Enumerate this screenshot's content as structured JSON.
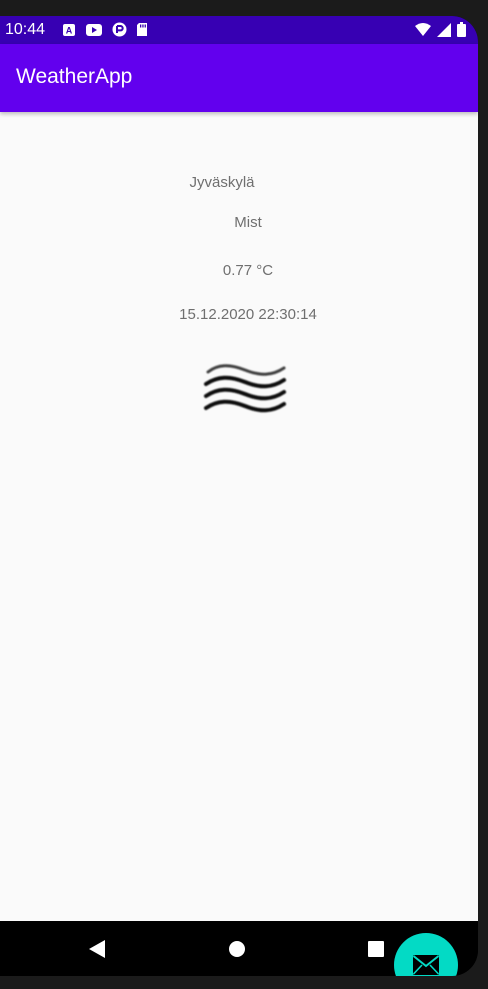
{
  "status_bar": {
    "time": "10:44",
    "left_icons": [
      "a-notification-icon",
      "youtube-icon",
      "pocketcasts-icon",
      "sd-card-icon"
    ],
    "right_icons": [
      "wifi-icon",
      "signal-icon",
      "battery-icon"
    ]
  },
  "app_bar": {
    "title": "WeatherApp",
    "color": "#6200ee",
    "status_color": "#3700b3"
  },
  "weather": {
    "city": "Jyväskylä",
    "condition": "Mist",
    "temperature": "0.77 °C",
    "timestamp": "15.12.2020 22:30:14",
    "icon": "mist-icon"
  },
  "fab": {
    "icon": "mail-icon",
    "color": "#03dac5"
  },
  "navigation": {
    "buttons": [
      "back-icon",
      "home-icon",
      "recents-icon"
    ]
  }
}
